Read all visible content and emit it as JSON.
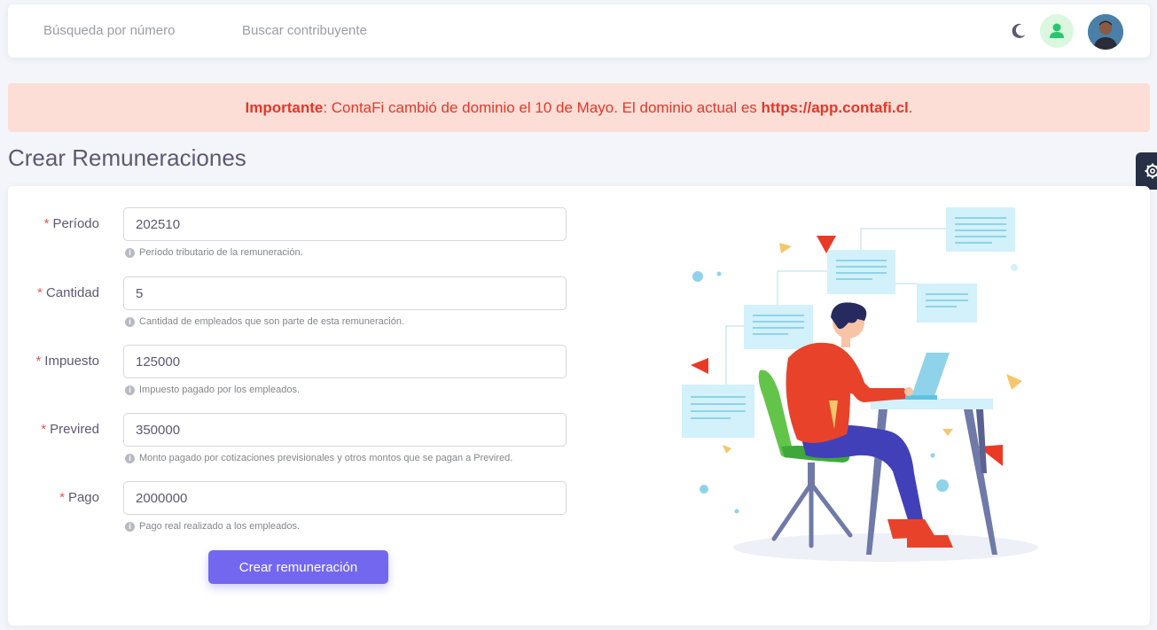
{
  "header": {
    "search_number_placeholder": "Búsqueda por número",
    "search_taxpayer_placeholder": "Buscar contribuyente"
  },
  "alert": {
    "strong_label": "Importante",
    "message": ": ContaFi cambió de dominio el 10 de Mayo. El dominio actual es ",
    "domain": "https://app.contafi.cl",
    "end": "."
  },
  "page": {
    "title": "Crear Remuneraciones"
  },
  "form": {
    "fields": [
      {
        "label": "Período",
        "value": "202510",
        "help": "Período tributario de la remuneración."
      },
      {
        "label": "Cantidad",
        "value": "5",
        "help": "Cantidad de empleados que son parte de esta remuneración."
      },
      {
        "label": "Impuesto",
        "value": "125000",
        "help": "Impuesto pagado por los empleados."
      },
      {
        "label": "Previred",
        "value": "350000",
        "help": "Monto pagado por cotizaciones previsionales y otros montos que se pagan a Previred."
      },
      {
        "label": "Pago",
        "value": "2000000",
        "help": "Pago real realizado a los empleados."
      }
    ],
    "required_mark": "*",
    "submit_label": "Crear remuneración"
  },
  "icons": {
    "theme": "moon-icon",
    "user": "user-icon",
    "info": "info-icon",
    "settings": "gear-icon"
  },
  "colors": {
    "primary": "#7367f0",
    "alert_bg": "#fcded6",
    "alert_text": "#e5372a",
    "required": "#ea5455"
  }
}
